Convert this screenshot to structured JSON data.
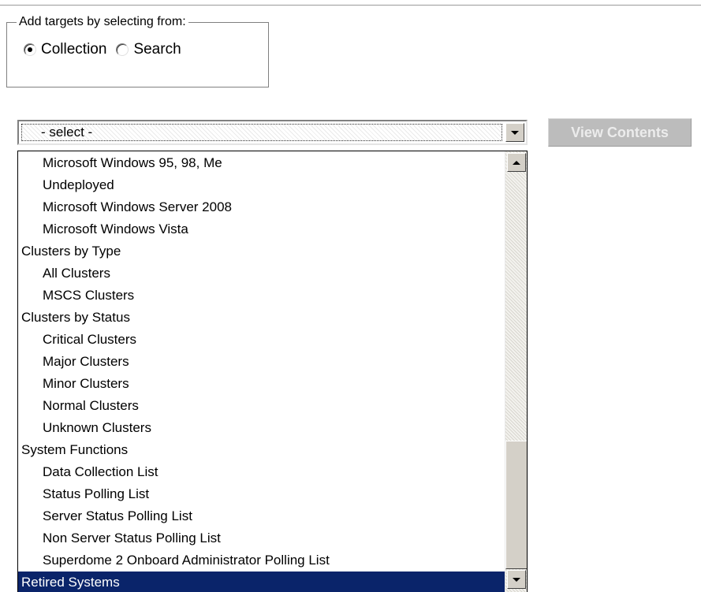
{
  "group": {
    "legend": "Add targets by selecting from:",
    "options": [
      {
        "label": "Collection",
        "checked": true
      },
      {
        "label": "Search",
        "checked": false
      }
    ]
  },
  "select": {
    "value": "- select -"
  },
  "view_contents_button": {
    "label": "View Contents",
    "enabled": false
  },
  "dropdown": {
    "items": [
      {
        "label": "Microsoft Windows 95, 98, Me",
        "level": 1
      },
      {
        "label": "Undeployed",
        "level": 1
      },
      {
        "label": "Microsoft Windows Server 2008",
        "level": 1
      },
      {
        "label": "Microsoft Windows Vista",
        "level": 1
      },
      {
        "label": "Clusters by Type",
        "level": 0
      },
      {
        "label": "All Clusters",
        "level": 1
      },
      {
        "label": "MSCS Clusters",
        "level": 1
      },
      {
        "label": "Clusters by Status",
        "level": 0
      },
      {
        "label": "Critical Clusters",
        "level": 1
      },
      {
        "label": "Major Clusters",
        "level": 1
      },
      {
        "label": "Minor Clusters",
        "level": 1
      },
      {
        "label": "Normal Clusters",
        "level": 1
      },
      {
        "label": "Unknown Clusters",
        "level": 1
      },
      {
        "label": "System Functions",
        "level": 0
      },
      {
        "label": "Data Collection List",
        "level": 1
      },
      {
        "label": "Status Polling List",
        "level": 1
      },
      {
        "label": "Server Status Polling List",
        "level": 1
      },
      {
        "label": "Non Server Status Polling List",
        "level": 1
      },
      {
        "label": "Superdome 2 Onboard Administrator Polling List",
        "level": 1
      },
      {
        "label": "Retired Systems",
        "level": 0,
        "selected": true
      }
    ]
  },
  "colors": {
    "selection": "#0a246a",
    "disabled_button": "#bcbcbc",
    "scrollbar_face": "#d4d0c8"
  },
  "icons": [
    "radio-selected-icon",
    "radio-unselected-icon",
    "chevron-down-icon",
    "scroll-up-arrow-icon",
    "scroll-down-arrow-icon"
  ]
}
